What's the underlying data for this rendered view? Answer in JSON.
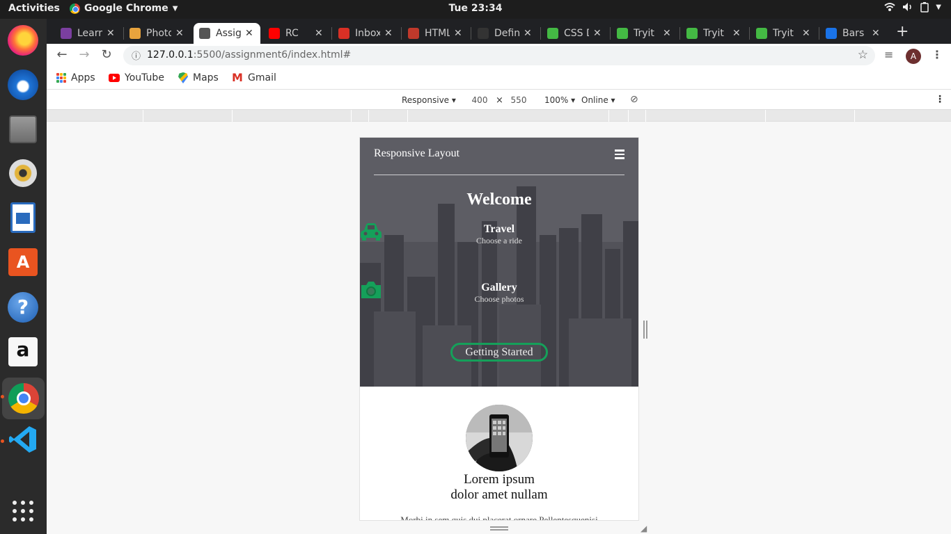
{
  "topbar": {
    "activities": "Activities",
    "app_name": "Google Chrome",
    "clock": "Tue 23:34"
  },
  "browser": {
    "tabs": [
      {
        "title": "Learr",
        "color": "#7b3fa0"
      },
      {
        "title": "Photo",
        "color": "#e8a33d"
      },
      {
        "title": "Assig",
        "color": "#555555",
        "active": true
      },
      {
        "title": "RC",
        "color": "#ff0000"
      },
      {
        "title": "Inbox",
        "color": "#d93025"
      },
      {
        "title": "HTML",
        "color": "#c0392b"
      },
      {
        "title": "Defin",
        "color": "#333333"
      },
      {
        "title": "CSS D",
        "color": "#44b944"
      },
      {
        "title": "Tryit",
        "color": "#44b944"
      },
      {
        "title": "Tryit",
        "color": "#44b944"
      },
      {
        "title": "Tryit",
        "color": "#44b944"
      },
      {
        "title": "Bars",
        "color": "#1a73e8"
      }
    ],
    "url_host": "127.0.0.1",
    "url_rest": ":5500/assignment6/index.html#",
    "avatar_letter": "A",
    "bookmarks": [
      "Apps",
      "YouTube",
      "Maps",
      "Gmail"
    ]
  },
  "devtools": {
    "device": "Responsive",
    "width": "400",
    "times": "×",
    "height": "550",
    "zoom": "100%",
    "network": "Online"
  },
  "page": {
    "brand": "Responsive Layout",
    "welcome": "Welcome",
    "features": [
      {
        "title": "Travel",
        "subtitle": "Choose a ride",
        "icon": "car-icon"
      },
      {
        "title": "Gallery",
        "subtitle": "Choose photos",
        "icon": "camera-icon"
      }
    ],
    "cta": "Getting Started",
    "accent": "#15a05a",
    "section_title_line1": "Lorem ipsum",
    "section_title_line2": "dolor amet nullam",
    "section_text": "Morbi in sem quis dui placerat ornare Pellentesquenisi"
  }
}
